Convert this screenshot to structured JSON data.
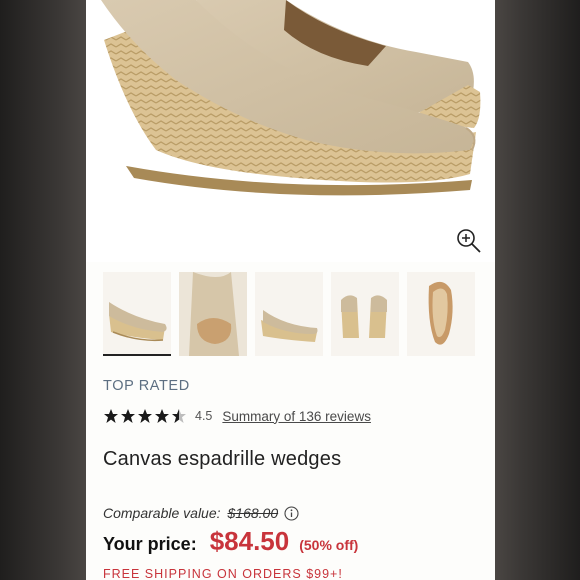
{
  "product": {
    "badge": "TOP RATED",
    "rating_value": "4.5",
    "rating_stars": 4.5,
    "reviews_link": "Summary of 136 reviews",
    "title": "Canvas espadrille wedges"
  },
  "pricing": {
    "comparable_label": "Comparable value:",
    "comparable_value": "$168.00",
    "your_price_label": "Your price:",
    "sale_price": "$84.50",
    "discount": "(50% off)"
  },
  "promo": {
    "shipping_text": "FREE SHIPPING ON ORDERS $99+!"
  },
  "gallery": {
    "active_thumb": 0,
    "thumb_count": 5,
    "zoom_icon": "zoom-in-icon"
  },
  "colors": {
    "sale_red": "#c8343b",
    "badge_blue": "#5d6f82",
    "canvas": "#d7c7ac",
    "jute": "#d9c08e"
  }
}
